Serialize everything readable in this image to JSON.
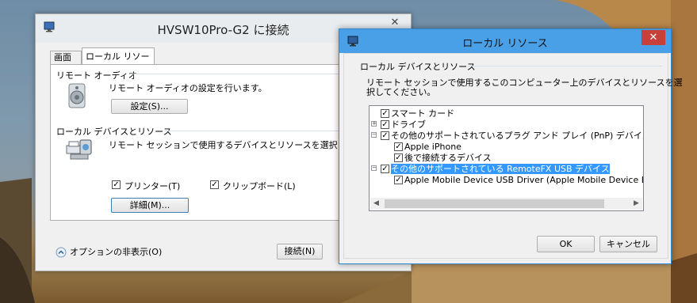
{
  "main_window": {
    "title": "HVSW10Pro-G2 に接続",
    "tabs": [
      {
        "label": "画面"
      },
      {
        "label": "ローカル リソース"
      }
    ],
    "remote_audio": {
      "group_title": "リモート オーディオ",
      "description": "リモート オーディオの設定を行います。",
      "settings_button": "設定(S)..."
    },
    "local_devices": {
      "group_title": "ローカル デバイスとリソース",
      "description": "リモート セッションで使用するデバイスとリソースを選択します。",
      "printer_label": "プリンター(T)",
      "printer_checked": true,
      "clipboard_label": "クリップボード(L)",
      "clipboard_checked": true,
      "details_button": "詳細(M)..."
    },
    "options_toggle": "オプションの非表示(O)",
    "connect_button": "接続(N)"
  },
  "dialog": {
    "title": "ローカル リソース",
    "close_glyph": "✕",
    "group_title": "ローカル デバイスとリソース",
    "description_line1": "リモート セッションで使用するこのコンピューター上のデバイスとリソースを選",
    "description_line2": "択してください。",
    "tree": [
      {
        "label": "スマート カード",
        "checked": true
      },
      {
        "label": "ドライブ",
        "checked": true,
        "expander": "+"
      },
      {
        "label": "その他のサポートされているプラグ アンド プレイ (PnP) デバイス",
        "checked": true,
        "expander": "−"
      },
      {
        "label": "Apple iPhone",
        "checked": true
      },
      {
        "label": "後で接続するデバイス",
        "checked": true
      },
      {
        "label": "その他のサポートされている RemoteFX USB デバイス",
        "checked": true,
        "expander": "−",
        "selected": true
      },
      {
        "label": "Apple Mobile Device USB Driver (Apple Mobile Device Eth",
        "checked": true
      }
    ],
    "ok_button": "OK",
    "cancel_button": "キャンセル"
  },
  "colors": {
    "dialog_titlebar": "#4aa0e6",
    "close_button": "#c7413a",
    "selection": "#3399ff"
  }
}
